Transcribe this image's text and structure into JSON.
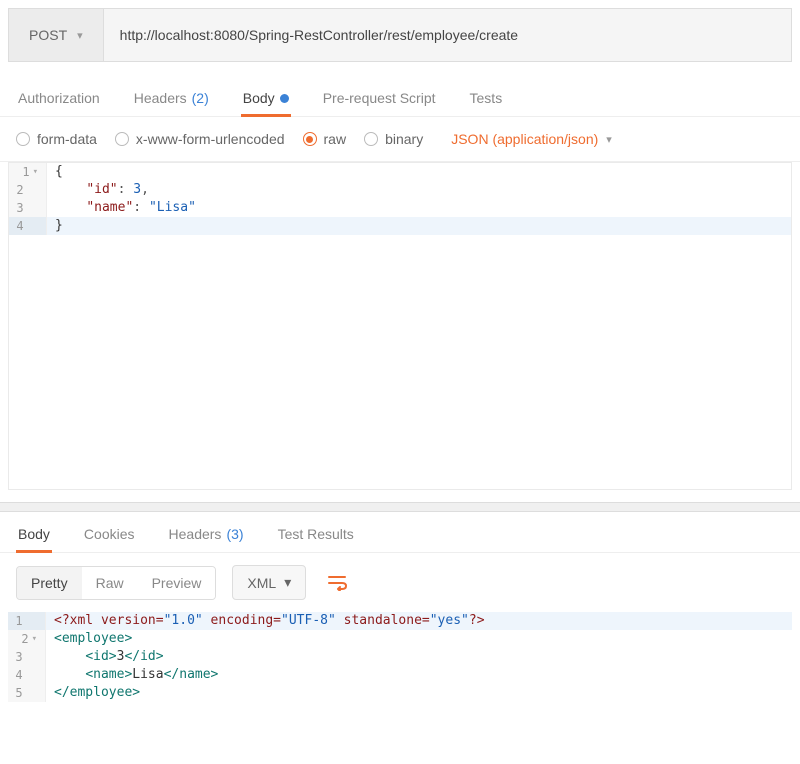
{
  "request": {
    "method": "POST",
    "url": "http://localhost:8080/Spring-RestController/rest/employee/create"
  },
  "tabs": {
    "auth": "Authorization",
    "headers": "Headers",
    "headers_count": "(2)",
    "body": "Body",
    "prerequest": "Pre-request Script",
    "tests": "Tests"
  },
  "body_opts": {
    "formdata": "form-data",
    "urlencoded": "x-www-form-urlencoded",
    "raw": "raw",
    "binary": "binary",
    "content_type": "JSON (application/json)"
  },
  "request_body": {
    "l1": "{",
    "l2_key": "\"id\"",
    "l2_val": "3",
    "l3_key": "\"name\"",
    "l3_val": "\"Lisa\"",
    "l4": "}"
  },
  "resp_tabs": {
    "body": "Body",
    "cookies": "Cookies",
    "headers": "Headers",
    "headers_count": "(3)",
    "tests": "Test Results"
  },
  "view": {
    "pretty": "Pretty",
    "raw": "Raw",
    "preview": "Preview",
    "format": "XML"
  },
  "response_body": {
    "l1_a": "<?xml ",
    "l1_b": "version=",
    "l1_c": "\"1.0\"",
    "l1_d": " encoding=",
    "l1_e": "\"UTF-8\"",
    "l1_f": " standalone=",
    "l1_g": "\"yes\"",
    "l1_h": "?>",
    "l2": "<employee>",
    "l3_open": "<id>",
    "l3_text": "3",
    "l3_close": "</id>",
    "l4_open": "<name>",
    "l4_text": "Lisa",
    "l4_close": "</name>",
    "l5": "</employee>"
  }
}
